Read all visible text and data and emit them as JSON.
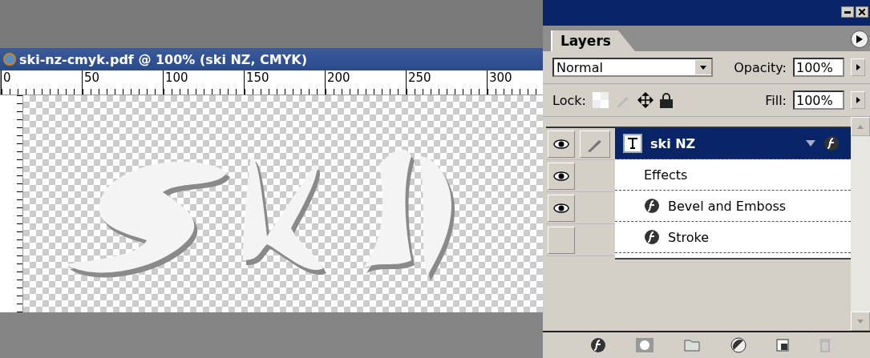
{
  "document": {
    "title": "ski-nz-cmyk.pdf @ 100% (ski NZ, CMYK)",
    "ruler_labels": [
      "0",
      "50",
      "100",
      "150",
      "200",
      "250",
      "300"
    ]
  },
  "layers_panel": {
    "tab": {
      "label": "Layers",
      "selected": true
    },
    "blend_mode": "Normal",
    "opacity_label": "Opacity:",
    "opacity": "100%",
    "lock_label": "Lock:",
    "fill_label": "Fill:",
    "fill": "100%",
    "rows": [
      {
        "kind": "layer",
        "label": "ski NZ",
        "visible": true,
        "selected": true,
        "brush": true
      },
      {
        "kind": "effects",
        "label": "Effects",
        "visible": true,
        "selected": false
      },
      {
        "kind": "effect",
        "label": "Bevel and Emboss",
        "visible": true,
        "selected": false
      },
      {
        "kind": "effect",
        "label": "Stroke",
        "visible": false,
        "selected": false
      }
    ]
  }
}
